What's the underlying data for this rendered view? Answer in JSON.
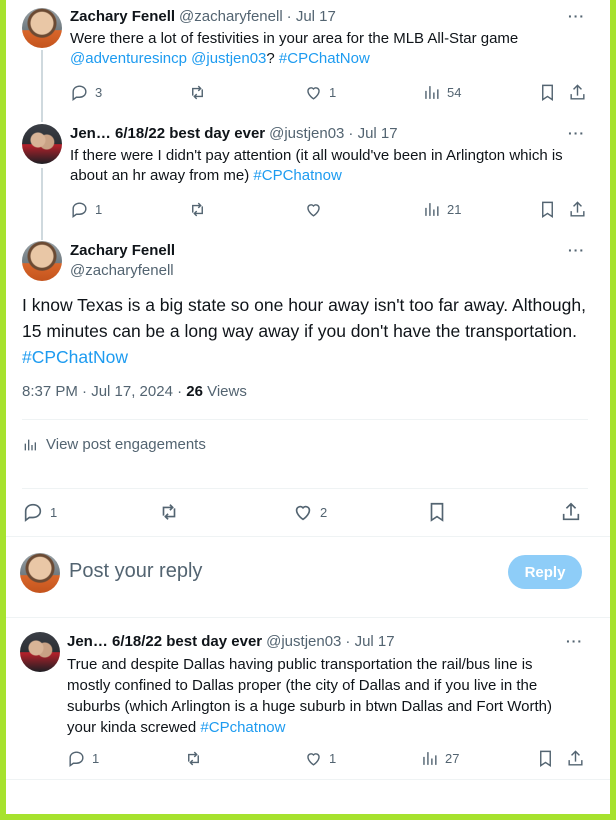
{
  "tweets": [
    {
      "name": "Zachary Fenell",
      "handle": "@zacharyfenell",
      "date": "· Jul 17",
      "text_plain": "Were there a lot of festivities in your area for the MLB All-Star game",
      "text_links": "@adventuresincp @justjen03",
      "text_mid": "?",
      "hashtag": "#CPChatNow",
      "replies": "3",
      "likes": "1",
      "views": "54"
    },
    {
      "name": "Jen… 6/18/22 best day ever",
      "handle": "@justjen03",
      "date": "· Jul 17",
      "text_line1": "If there were I didn't pay attention (it all would've been in Arlington which is",
      "text_line2": "about an hr away from me)",
      "hashtag": "#CPChatnow",
      "replies": "1",
      "views": "21"
    }
  ],
  "main": {
    "name": "Zachary Fenell",
    "handle": "@zacharyfenell",
    "text_line1": "I know Texas is a big state so one hour away isn't too far away. Although,",
    "text_line2": "15 minutes can be a long way away if you don't have the transportation.",
    "hashtag": "#CPChatNow",
    "timestamp": "8:37 PM · Jul 17, 2024 · ",
    "views_count": "26",
    "views_label": " Views",
    "engagements": "View post engagements",
    "replies": "1",
    "likes": "2"
  },
  "reply_box": {
    "placeholder": "Post your reply",
    "button": "Reply"
  },
  "reply": {
    "name": "Jen… 6/18/22 best day ever",
    "handle": "@justjen03",
    "date": "· Jul 17",
    "line1": "True and despite Dallas having public transportation the rail/bus line is",
    "line2": "mostly confined to Dallas proper (the city of Dallas and if you live in the",
    "line3": "suburbs (which Arlington is a huge suburb in btwn Dallas and Fort Worth)",
    "line4": "your kinda screwed",
    "hashtag": "#CPchatnow",
    "replies": "1",
    "likes": "1",
    "views": "27"
  },
  "more_label": "···",
  "colors": {
    "accent": "#1d9bf0",
    "frame": "#a6e22e",
    "muted": "#536471",
    "reply_button": "#8ecdf8"
  }
}
